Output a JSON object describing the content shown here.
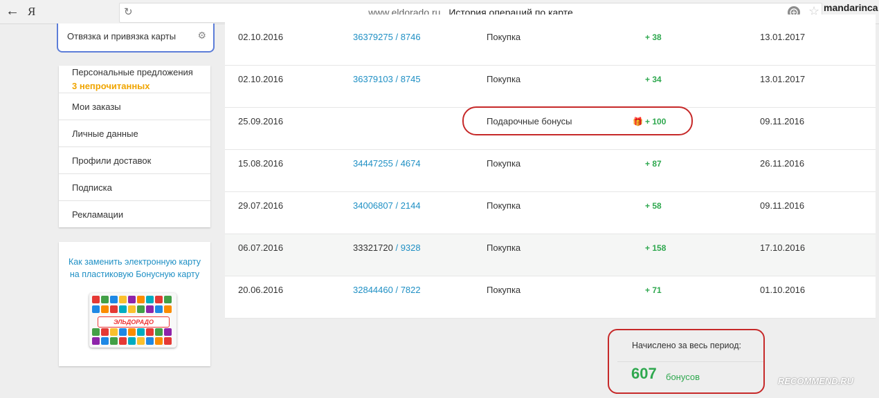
{
  "browser": {
    "back_icon": "←",
    "brand": "Я",
    "reload_icon": "↻",
    "domain": "www.eldorado.ru",
    "page_title": "История операций по карте",
    "protect_icon": "shield-icon",
    "bookmark_icon": "☆",
    "user": "mandarinca"
  },
  "sidebar": {
    "card_link": {
      "label": "Отвязка и привязка карты",
      "gear": "⚙"
    },
    "menu": [
      {
        "label": "Персональные предложения",
        "sub": "3 непрочитанных"
      },
      {
        "label": "Мои заказы"
      },
      {
        "label": "Личные данные"
      },
      {
        "label": "Профили доставок"
      },
      {
        "label": "Подписка"
      },
      {
        "label": "Рекламации"
      }
    ],
    "promo": {
      "line1": "Как заменить электронную карту",
      "line2": "на пластиковую Бонусную карту",
      "logo": "ЭЛЬДОРАДО"
    }
  },
  "operations": [
    {
      "date": "02.10.2016",
      "order": "36379275",
      "store": "8746",
      "type": "Покупка",
      "gift": "",
      "bonus": "+ 38",
      "expires": "13.01.2017"
    },
    {
      "date": "02.10.2016",
      "order": "36379103",
      "store": "8745",
      "type": "Покупка",
      "gift": "",
      "bonus": "+ 34",
      "expires": "13.01.2017"
    },
    {
      "date": "25.09.2016",
      "order": "",
      "store": "",
      "type": "Подарочные бонусы",
      "gift": "🎁",
      "bonus": "+ 100",
      "expires": "09.11.2016"
    },
    {
      "date": "15.08.2016",
      "order": "34447255",
      "store": "4674",
      "type": "Покупка",
      "gift": "",
      "bonus": "+ 87",
      "expires": "26.11.2016"
    },
    {
      "date": "29.07.2016",
      "order": "34006807",
      "store": "2144",
      "type": "Покупка",
      "gift": "",
      "bonus": "+ 58",
      "expires": "09.11.2016"
    },
    {
      "date": "06.07.2016",
      "order": "33321720",
      "store": "9328",
      "type": "Покупка",
      "gift": "",
      "bonus": "+ 158",
      "expires": "17.10.2016"
    },
    {
      "date": "20.06.2016",
      "order": "32844460",
      "store": "7822",
      "type": "Покупка",
      "gift": "",
      "bonus": "+ 71",
      "expires": "01.10.2016"
    }
  ],
  "summary": {
    "title": "Начислено за весь период:",
    "total": "607",
    "unit": "бонусов"
  },
  "watermark": "RECOMMEND.RU",
  "colors": {
    "link": "#1e8fc4",
    "bonus": "#2fa84f",
    "unread": "#f0a500",
    "highlight": "#c62828"
  }
}
